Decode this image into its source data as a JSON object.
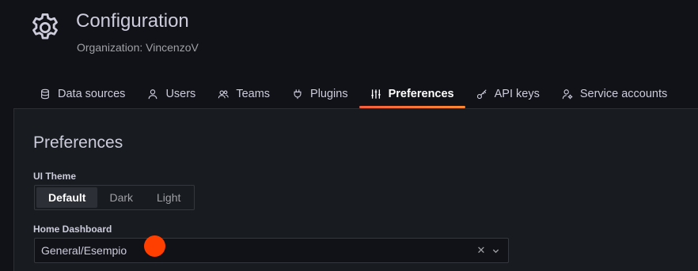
{
  "header": {
    "icon": "gear-icon",
    "title": "Configuration",
    "subtitle": "Organization: VincenzoV"
  },
  "tabs": [
    {
      "label": "Data sources",
      "icon": "database-icon",
      "active": false
    },
    {
      "label": "Users",
      "icon": "user-icon",
      "active": false
    },
    {
      "label": "Teams",
      "icon": "users-icon",
      "active": false
    },
    {
      "label": "Plugins",
      "icon": "plug-icon",
      "active": false
    },
    {
      "label": "Preferences",
      "icon": "sliders-icon",
      "active": true
    },
    {
      "label": "API keys",
      "icon": "key-icon",
      "active": false
    },
    {
      "label": "Service accounts",
      "icon": "user-cog-icon",
      "active": false
    }
  ],
  "preferences": {
    "section_title": "Preferences",
    "ui_theme": {
      "label": "UI Theme",
      "options": [
        "Default",
        "Dark",
        "Light"
      ],
      "selected": "Default"
    },
    "home_dashboard": {
      "label": "Home Dashboard",
      "value": "General/Esempio",
      "clear_icon": "close-icon",
      "chevron_icon": "chevron-down-icon"
    }
  },
  "colors": {
    "background": "#111217",
    "panel": "#181b1f",
    "accent_start": "#f55f3e",
    "accent_end": "#ff8833",
    "cursor_marker": "#ff3f00"
  }
}
